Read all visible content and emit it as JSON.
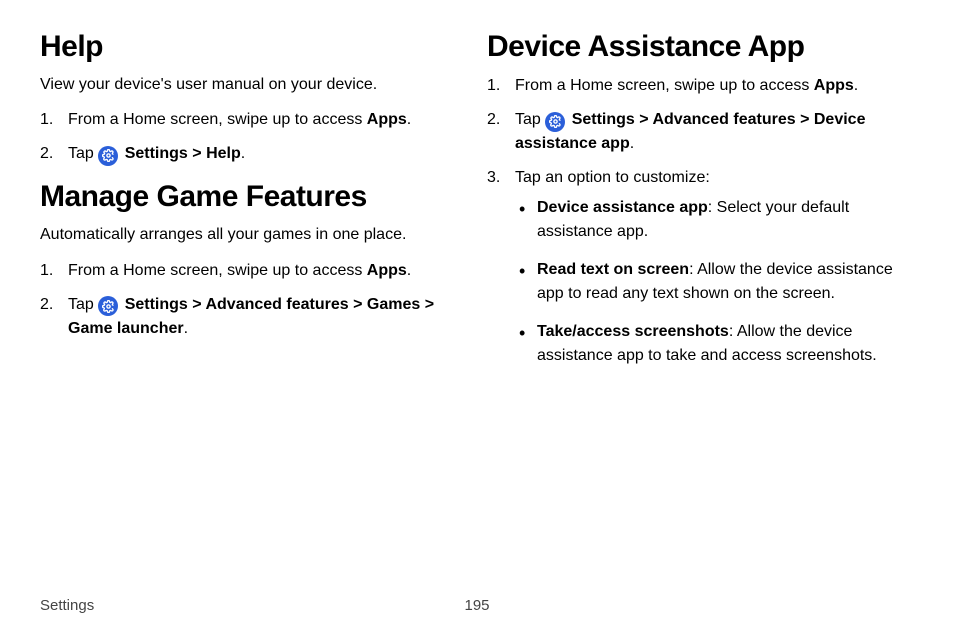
{
  "left": {
    "help": {
      "title": "Help",
      "intro": "View your device's user manual on your device.",
      "step1_a": "From a Home screen, swipe up to access ",
      "step1_b": "Apps",
      "step1_c": ".",
      "step2_a": "Tap ",
      "step2_b": "Settings",
      "step2_c": " > ",
      "step2_d": "Help",
      "step2_e": "."
    },
    "games": {
      "title": "Manage Game Features",
      "intro": "Automatically arranges all your games in one place.",
      "step1_a": "From a Home screen, swipe up to access ",
      "step1_b": "Apps",
      "step1_c": ".",
      "step2_a": "Tap ",
      "step2_b": "Settings",
      "step2_c": " > ",
      "step2_d": "Advanced features",
      "step2_e": " > ",
      "step2_f": "Games",
      "step2_g": " > ",
      "step2_h": "Game launcher",
      "step2_i": "."
    }
  },
  "right": {
    "assist": {
      "title": "Device Assistance App",
      "step1_a": "From a Home screen, swipe up to access ",
      "step1_b": "Apps",
      "step1_c": ".",
      "step2_a": "Tap ",
      "step2_b": "Settings",
      "step2_c": " > ",
      "step2_d": "Advanced features",
      "step2_e": " > ",
      "step2_f": "Device assistance app",
      "step2_g": ".",
      "step3": "Tap an option to customize:",
      "b1_a": "Device assistance app",
      "b1_b": ": Select your default assistance app.",
      "b2_a": "Read text on screen",
      "b2_b": ": Allow the device assistance app to read any text shown on the screen.",
      "b3_a": "Take/access screenshots",
      "b3_b": ": Allow the device assistance app to take and access screenshots."
    }
  },
  "footer": {
    "section": "Settings",
    "page": "195"
  }
}
